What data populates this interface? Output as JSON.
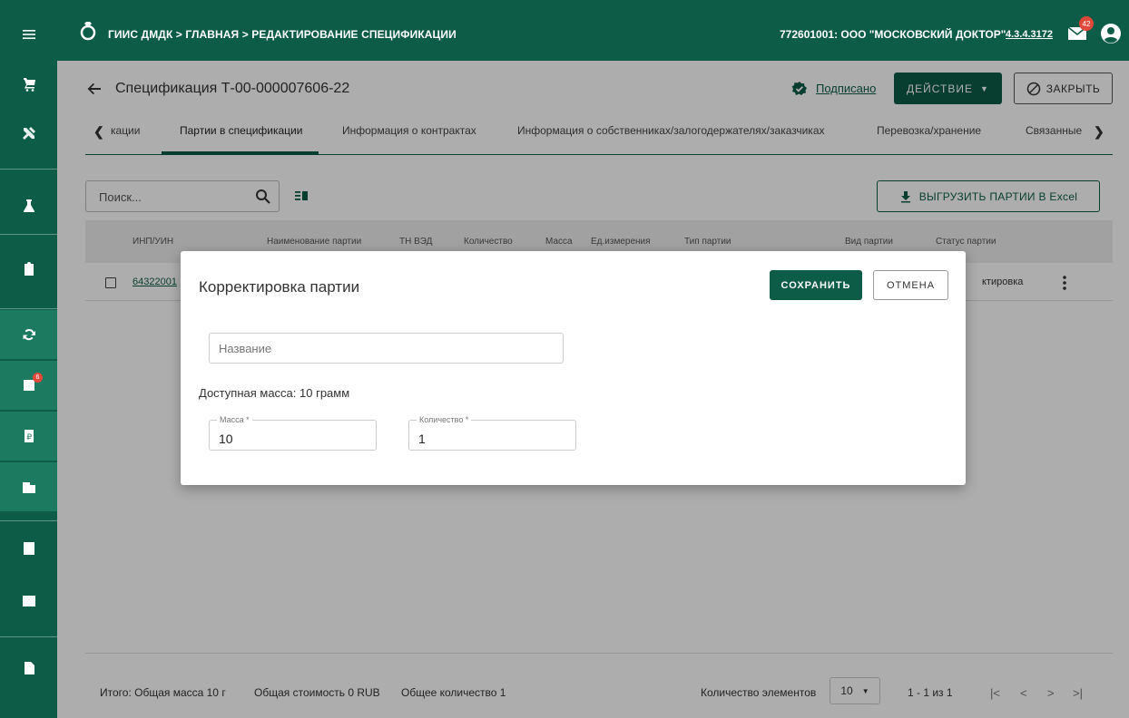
{
  "topbar": {
    "breadcrumb": "ГИИС ДМДК > ГЛАВНАЯ > РЕДАКТИРОВАНИЕ СПЕЦИФИКАЦИИ",
    "org": "772601001: ООО \"МОСКОВСКИЙ ДОКТОР\"",
    "version": "4.3.4.3172",
    "mail_count": "42"
  },
  "sidebar": {
    "notification_badge": "6",
    "items": [
      "cart-icon",
      "tools-icon",
      "flask-icon",
      "clipboard-icon",
      "sync-icon",
      "registry-icon",
      "payment-icon",
      "building-icon",
      "contact-icon",
      "checklist-icon",
      "document-icon"
    ]
  },
  "header": {
    "title": "Спецификация Т-00-000007606-22",
    "signed": "Подписано",
    "action": "ДЕЙСТВИЕ",
    "close": "ЗАКРЫТЬ"
  },
  "tabs": [
    {
      "label": "кации"
    },
    {
      "label": "Партии в спецификации"
    },
    {
      "label": "Информация о контрактах"
    },
    {
      "label": "Информация о собственниках/залогодержателях/заказчиках"
    },
    {
      "label": "Перевозка/хранение"
    },
    {
      "label": "Связанные"
    }
  ],
  "search": {
    "placeholder": "Поиск..."
  },
  "export_label": "ВЫГРУЗИТЬ ПАРТИИ В Excel",
  "table": {
    "headers": [
      "ИНП/УИН",
      "Наименование партии",
      "ТН ВЭД",
      "Количество",
      "Масса",
      "Ед.измерения",
      "Тип партии",
      "Вид партии",
      "Статус партии"
    ],
    "row": {
      "id": "64322001",
      "status": "ктировка"
    }
  },
  "footer": {
    "total_mass": "Итого: Общая масса 10 г",
    "total_cost": "Общая стоимость 0 RUB",
    "total_qty": "Общее количество 1",
    "page_size_label": "Количество элементов",
    "page_size": "10",
    "range": "1 - 1 из 1"
  },
  "modal": {
    "title": "Корректировка партии",
    "save": "СОХРАНИТЬ",
    "cancel": "ОТМЕНА",
    "name_placeholder": "Название",
    "available": "Доступная масса: 10 грамм",
    "mass_label": "Масса *",
    "mass_value": "10",
    "qty_label": "Количество *",
    "qty_value": "1"
  },
  "colors": {
    "brand": "#0d5c47",
    "badge": "#e0483a"
  }
}
